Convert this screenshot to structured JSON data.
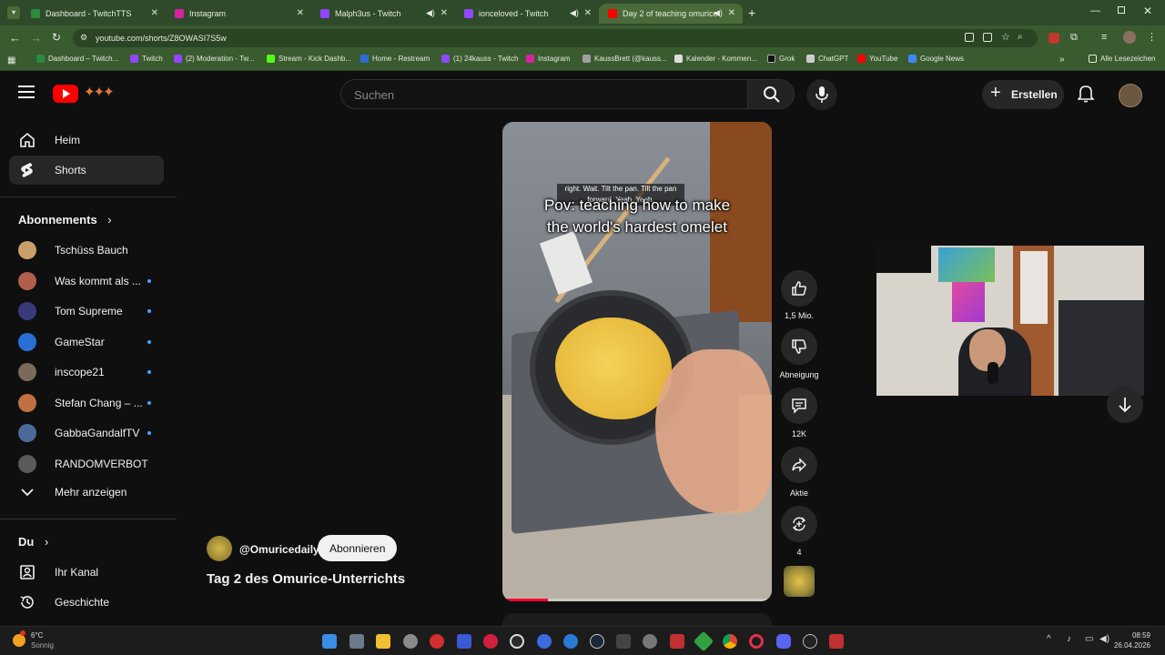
{
  "browser": {
    "tabs": [
      {
        "title": "Dashboard - TwitchTTS",
        "color": "#2b8a3e"
      },
      {
        "title": "Instagram",
        "color": "#d6249f"
      },
      {
        "title": "Malph3us - Twitch",
        "color": "#9146ff"
      },
      {
        "title": "ionceloved - Twitch",
        "color": "#9146ff"
      },
      {
        "title": "Day 2 of teaching omurice",
        "color": "#ff0000"
      }
    ],
    "url": "youtube.com/shorts/Z8OWASI7S5w",
    "bookmarks": [
      "Dashboard – Twitch...",
      "Twitch",
      "(2) Moderation - Tw...",
      "Stream - Kick Dashb...",
      "Home - Restream",
      "(1) 24kauss - Twitch",
      "Instagram",
      "KaussBrett (@kauss...",
      "Kalender - Kommen...",
      "Grok",
      "ChatGPT",
      "YouTube",
      "Google News"
    ],
    "all_bookmarks": "Alle Lesezeichen"
  },
  "youtube": {
    "search_placeholder": "Suchen",
    "create_label": "Erstellen",
    "nav": {
      "home": "Heim",
      "shorts": "Shorts"
    },
    "subscriptions_title": "Abonnements",
    "subscriptions": [
      {
        "name": "Tschüss Bauch",
        "dot": false,
        "color": "#c9a06a"
      },
      {
        "name": "Was kommt als ...",
        "dot": true,
        "color": "#b0604a"
      },
      {
        "name": "Tom Supreme",
        "dot": true,
        "color": "#3a3a7a"
      },
      {
        "name": "GameStar",
        "dot": true,
        "color": "#2a6fd6"
      },
      {
        "name": "inscope21",
        "dot": true,
        "color": "#7a6a5a"
      },
      {
        "name": "Stefan Chang – ...",
        "dot": true,
        "color": "#c07040"
      },
      {
        "name": "GabbaGandalfTV",
        "dot": true,
        "color": "#4a6a9a"
      },
      {
        "name": "RANDOMVERBOT",
        "dot": false,
        "color": "#5a5a5a"
      }
    ],
    "show_more": "Mehr anzeigen",
    "you_title": "Du",
    "you_items": {
      "channel": "Ihr Kanal",
      "history": "Geschichte"
    },
    "short": {
      "caption_small": "right. Wait. Tilt the pan. Tilt the pan forward. Yeah. Yeah.",
      "caption_line1": "Pov: teaching how to make",
      "caption_line2": "the world's hardest omelet",
      "channel": "@Omuricedaily",
      "subscribe": "Abonnieren",
      "title": "Tag 2 des Omurice-Unterrichts",
      "likes": "1,5 Mio.",
      "dislike": "Abneigung",
      "comments": "12K",
      "share": "Aktie",
      "remix": "4",
      "progress": 0.17
    }
  },
  "taskbar": {
    "weather_temp": "6°C",
    "weather_desc": "Sonnig",
    "time": "08:59",
    "date": "26.04.2026"
  }
}
